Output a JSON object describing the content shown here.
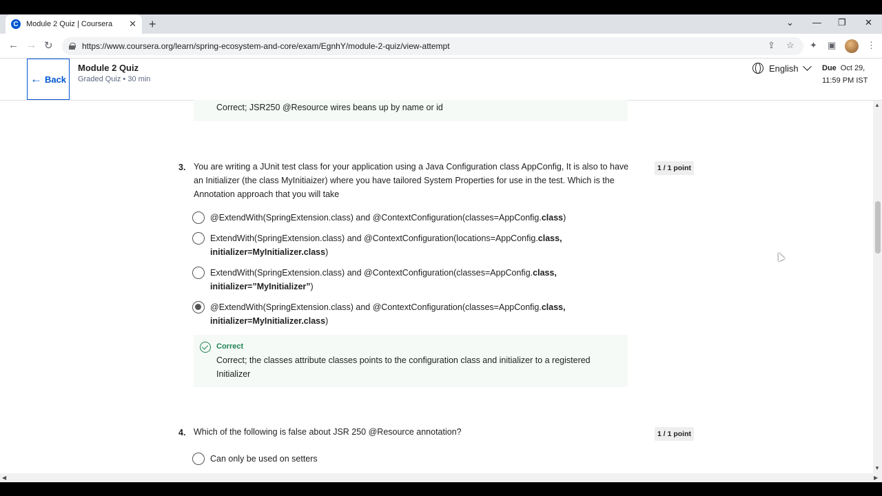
{
  "browser": {
    "tab_title": "Module 2 Quiz | Coursera",
    "tab_favicon": "C",
    "url": "https://www.coursera.org/learn/spring-ecosystem-and-core/exam/EgnhY/module-2-quiz/view-attempt"
  },
  "header": {
    "back_label": "Back",
    "title": "Module 2 Quiz",
    "subtitle": "Graded Quiz • 30 min",
    "language": "English",
    "due_label": "Due",
    "due_date": "Oct 29,",
    "due_time": "11:59 PM IST"
  },
  "prev_feedback": {
    "text": "Correct; JSR250 @Resource wires beans up by name or id"
  },
  "question3": {
    "number": "3.",
    "text": "You are writing a JUnit test class for your application using a Java Configuration class AppConfig,  It is also to have an Initializer (the class MyInitiaizer) where you have tailored System Properties for use in the test. Which is the Annotation approach that you will take",
    "points": "1 / 1 point",
    "options": [
      {
        "pre": "@ExtendWith(SpringExtension.class) and @ContextConfiguration(classes=AppConfig.",
        "bold": "class",
        "post": ")",
        "selected": false
      },
      {
        "pre": " ExtendWith(SpringExtension.class) and @ContextConfiguration(locations=AppConfig.",
        "bold": "class, initializer=MyInitializer.class",
        "post": ")",
        "selected": false
      },
      {
        "pre": "ExtendWith(SpringExtension.class) and @ContextConfiguration(classes=AppConfig.",
        "bold": "class, initializer=”MyInitializer”",
        "post": ")",
        "selected": false
      },
      {
        "pre": "@ExtendWith(SpringExtension.class) and @ContextConfiguration(classes=AppConfig.",
        "bold": "class, initializer=MyInitializer.class",
        "post": ")",
        "selected": true
      }
    ],
    "feedback_label": "Correct",
    "feedback_text": "Correct; the classes attribute classes points to the configuration class and initializer to a registered Initializer"
  },
  "question4": {
    "number": "4.",
    "text": "Which of the following is false about  JSR 250 @Resource annotation?",
    "points": "1 / 1 point",
    "options": [
      {
        "text": "Can only be used on setters",
        "selected": false
      }
    ]
  },
  "colors": {
    "brand": "#0056d2",
    "correct": "#1f8354",
    "feedback_bg": "#f5faf6"
  }
}
